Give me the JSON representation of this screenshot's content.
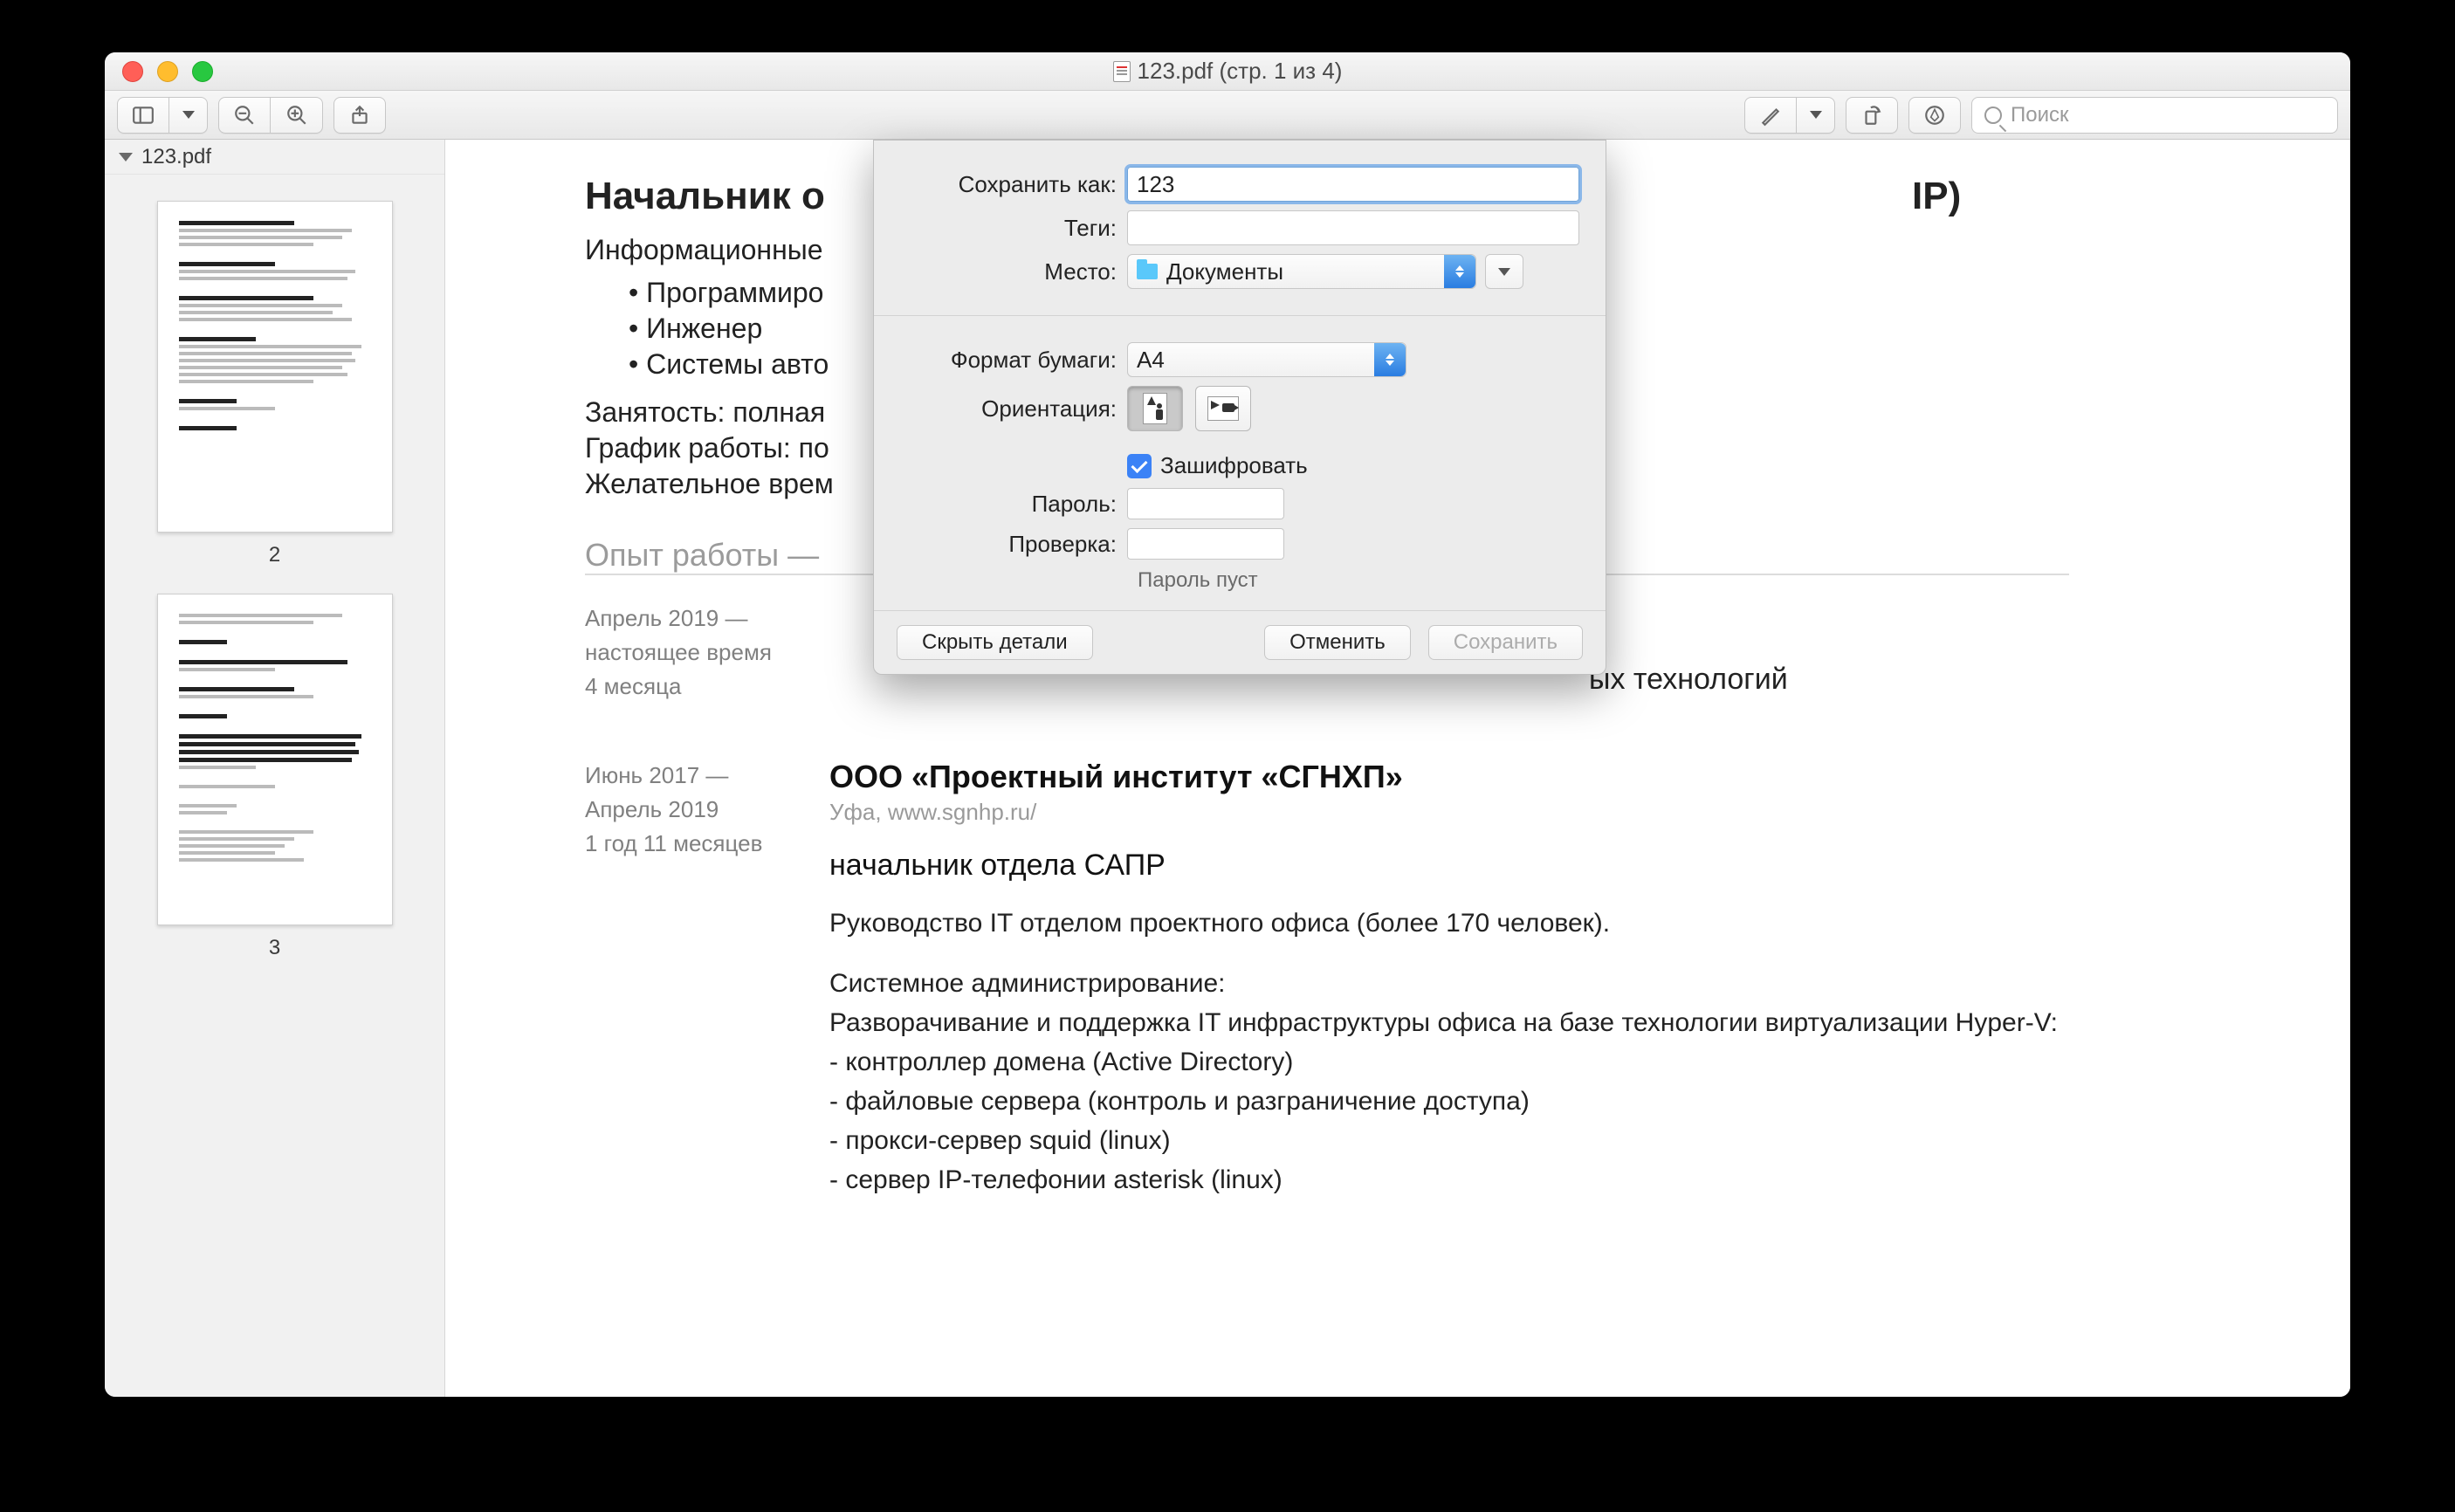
{
  "window": {
    "title": "123.pdf (стр. 1 из 4)"
  },
  "toolbar": {
    "search_placeholder": "Поиск"
  },
  "sidebar": {
    "file_name": "123.pdf",
    "thumbs": [
      {
        "label": "2"
      },
      {
        "label": "3"
      }
    ]
  },
  "document": {
    "h1_left": "Начальник о",
    "h1_right": "ІР)",
    "lead": "Информационные",
    "bullets": [
      "Программиро",
      "Инженер",
      "Системы авто"
    ],
    "lines": [
      "Занятость: полная",
      "График работы: по",
      "Желательное врем"
    ],
    "section_header": "Опыт работы —",
    "entries": [
      {
        "period_top": "Апрель 2019 —",
        "period_mid": "настоящее время",
        "period_bot": "4 месяца",
        "right_tail": "ых технологий"
      },
      {
        "period_top": "Июнь 2017 —",
        "period_mid": "Апрель 2019",
        "period_bot": "1 год 11 месяцев",
        "company": "ООО «Проектный институт «СГНХП»",
        "company_sub": "Уфа, www.sgnhp.ru/",
        "job_title": "начальник отдела САПР",
        "p1": "Руководство IT отделом проектного офиса (более 170 человек).",
        "p2_head": "Системное администрирование:",
        "p2_l1": "Разворачивание и поддержка IT инфраструктуры офиса на базе технологии виртуализации Hyper-V:",
        "p2_l2": "- контроллер домена (Active Directory)",
        "p2_l3": "- файловые сервера (контроль и разграничение доступа)",
        "p2_l4": "- прокси-сервер squid (linux)",
        "p2_l5": "- сервер IP-телефонии asterisk (linux)"
      }
    ]
  },
  "dialog": {
    "save_as_label": "Сохранить как:",
    "save_as_value": "123",
    "tags_label": "Теги:",
    "tags_value": "",
    "location_label": "Место:",
    "location_value": "Документы",
    "paper_label": "Формат бумаги:",
    "paper_value": "A4",
    "orient_label": "Ориентация:",
    "encrypt_label": "Зашифровать",
    "password_label": "Пароль:",
    "verify_label": "Проверка:",
    "hint": "Пароль пуст",
    "hide_details": "Скрыть детали",
    "cancel": "Отменить",
    "save": "Сохранить"
  }
}
